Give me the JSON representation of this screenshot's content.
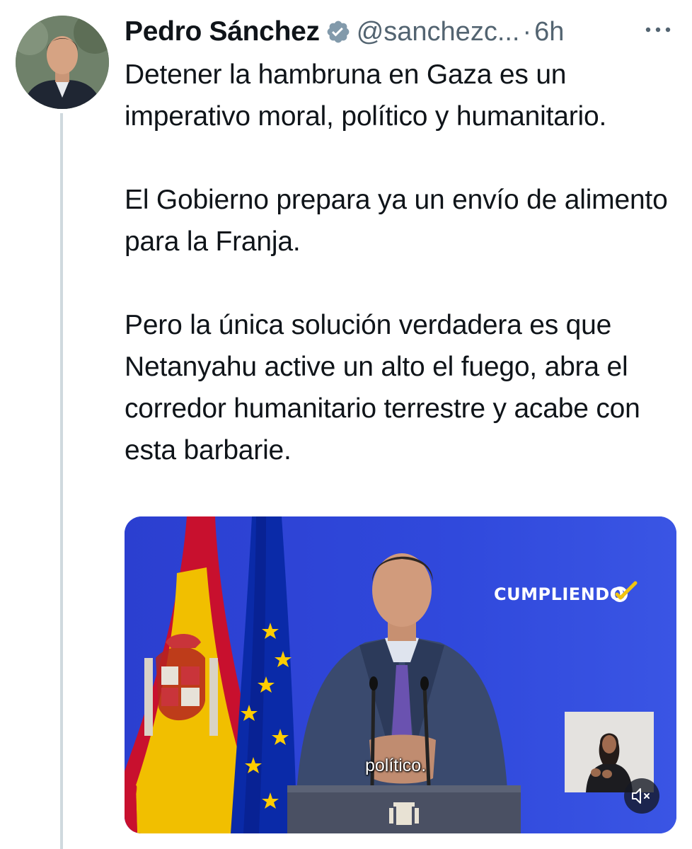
{
  "author": {
    "name": "Pedro Sánchez",
    "handle": "@sanchezc...",
    "separator": "·",
    "time": "6h",
    "avatar_icon": "profile-photo",
    "verified_icon": "verified-badge-icon"
  },
  "tweet": {
    "paragraphs": [
      "Detener la hambruna en Gaza es un imperativo moral, político y humanitario.",
      "El Gobierno prepara ya un envío de alimento para la Franja.",
      "Pero la única solución verdadera es que Netanyahu active un alto el fuego, abra el corredor humanitario terrestre y acabe con esta barbarie."
    ]
  },
  "media": {
    "brand_text": "CUMPLIENDO",
    "caption": "político.",
    "mute_icon": "speaker-muted-icon"
  },
  "colors": {
    "backdrop_blue": "#2f46d9",
    "verified_gray": "#829aab",
    "secondary_text": "#536471",
    "thread_line": "#cfd9de",
    "flag_red": "#c8102e",
    "flag_yellow": "#f1bf00",
    "eu_blue": "#003399",
    "eu_star": "#ffcc00"
  }
}
